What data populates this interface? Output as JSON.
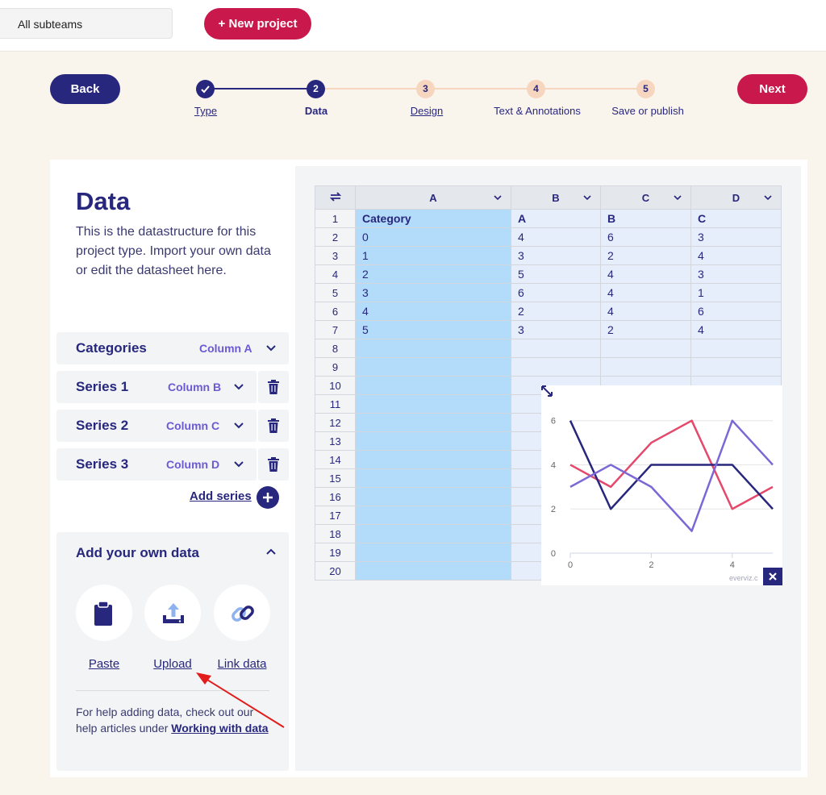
{
  "topbar": {
    "subteams_label": "All subteams",
    "new_project_label": "+ New project"
  },
  "stepper": {
    "back_label": "Back",
    "next_label": "Next",
    "steps": [
      {
        "number": "✓",
        "label": "Type",
        "state": "done"
      },
      {
        "number": "2",
        "label": "Data",
        "state": "current"
      },
      {
        "number": "3",
        "label": "Design",
        "state": "future"
      },
      {
        "number": "4",
        "label": "Text & Annotations",
        "state": "future"
      },
      {
        "number": "5",
        "label": "Save or publish",
        "state": "future"
      }
    ]
  },
  "data_panel": {
    "title": "Data",
    "description": "This is the datastructure for this project type. Import your own data or edit the datasheet here.",
    "rows": [
      {
        "label": "Categories",
        "column": "Column A",
        "deletable": false
      },
      {
        "label": "Series 1",
        "column": "Column B",
        "deletable": true
      },
      {
        "label": "Series 2",
        "column": "Column C",
        "deletable": true
      },
      {
        "label": "Series 3",
        "column": "Column D",
        "deletable": true
      }
    ],
    "add_series_label": "Add series",
    "own_data": {
      "title": "Add your own data",
      "tools": [
        {
          "label": "Paste",
          "icon": "clipboard-icon"
        },
        {
          "label": "Upload",
          "icon": "upload-icon"
        },
        {
          "label": "Link data",
          "icon": "link-icon"
        }
      ],
      "help_text": "For help adding data, check out our help articles under ",
      "help_link": "Working with data"
    }
  },
  "sheet": {
    "columns": [
      "A",
      "B",
      "C",
      "D"
    ],
    "row_numbers": [
      "1",
      "2",
      "3",
      "4",
      "5",
      "6",
      "7",
      "8",
      "9",
      "10",
      "11",
      "12",
      "13",
      "14",
      "15",
      "16",
      "17",
      "18",
      "19",
      "20"
    ],
    "rows": [
      [
        "Category",
        "A",
        "B",
        "C"
      ],
      [
        "0",
        "4",
        "6",
        "3"
      ],
      [
        "1",
        "3",
        "2",
        "4"
      ],
      [
        "2",
        "5",
        "4",
        "3"
      ],
      [
        "3",
        "6",
        "4",
        "1"
      ],
      [
        "4",
        "2",
        "4",
        "6"
      ],
      [
        "5",
        "3",
        "2",
        "4"
      ]
    ]
  },
  "chart_data": {
    "type": "line",
    "x": [
      0,
      1,
      2,
      3,
      4,
      5
    ],
    "x_ticks": [
      "0",
      "2",
      "4"
    ],
    "y_ticks": [
      "0",
      "2",
      "4",
      "6"
    ],
    "ylim": [
      0,
      6.5
    ],
    "series": [
      {
        "name": "A",
        "color": "#e4486b",
        "values": [
          4,
          3,
          5,
          6,
          2,
          3
        ]
      },
      {
        "name": "B",
        "color": "#28277e",
        "values": [
          6,
          2,
          4,
          4,
          4,
          2
        ]
      },
      {
        "name": "C",
        "color": "#7b68d6",
        "values": [
          3,
          4,
          3,
          1,
          6,
          4
        ]
      }
    ],
    "watermark": "everviz.c"
  },
  "colors": {
    "navy": "#28277e",
    "crimson": "#c8184c",
    "peach": "#f7d6bf",
    "light_blue": "#b3dcfa",
    "annotation_arrow": "#e21b1b"
  }
}
